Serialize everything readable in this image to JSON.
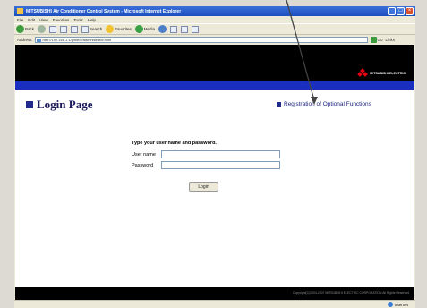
{
  "window": {
    "title": "MITSUBISHI Air Conditioner Control System - Microsoft Internet Explorer",
    "buttons": {
      "minimize": "_",
      "maximize": "□",
      "close": "×"
    }
  },
  "menubar": {
    "items": [
      "File",
      "Edit",
      "View",
      "Favorites",
      "Tools",
      "Help"
    ]
  },
  "toolbar": {
    "back": "Back",
    "search": "Search",
    "favorites": "Favorites",
    "media": "Media"
  },
  "addressbar": {
    "label": "Address",
    "url": "http://192.168.1.1/g/file/e/administrator.html",
    "go": "Go",
    "links": "Links"
  },
  "header": {
    "logo_text": "MITSUBISHI ELECTRIC"
  },
  "page": {
    "title": "Login Page",
    "registration_link": "Registration of Optional Functions"
  },
  "login": {
    "prompt": "Type your user name and password.",
    "username_label": "User name",
    "password_label": "Password",
    "username_value": "",
    "password_value": "",
    "button_label": "Login"
  },
  "footer": {
    "copyright": "Copyright(C)2004-2007 MITSUBISHI ELECTRIC CORPORATION All Rights Reserved"
  },
  "statusbar": {
    "zone": "Internet"
  },
  "colors": {
    "title_bar": "#1d4fbf",
    "band": "#000000",
    "blue_line": "#1a2fc0",
    "title_text": "#1a1a5c",
    "background": "#dcdad2"
  }
}
